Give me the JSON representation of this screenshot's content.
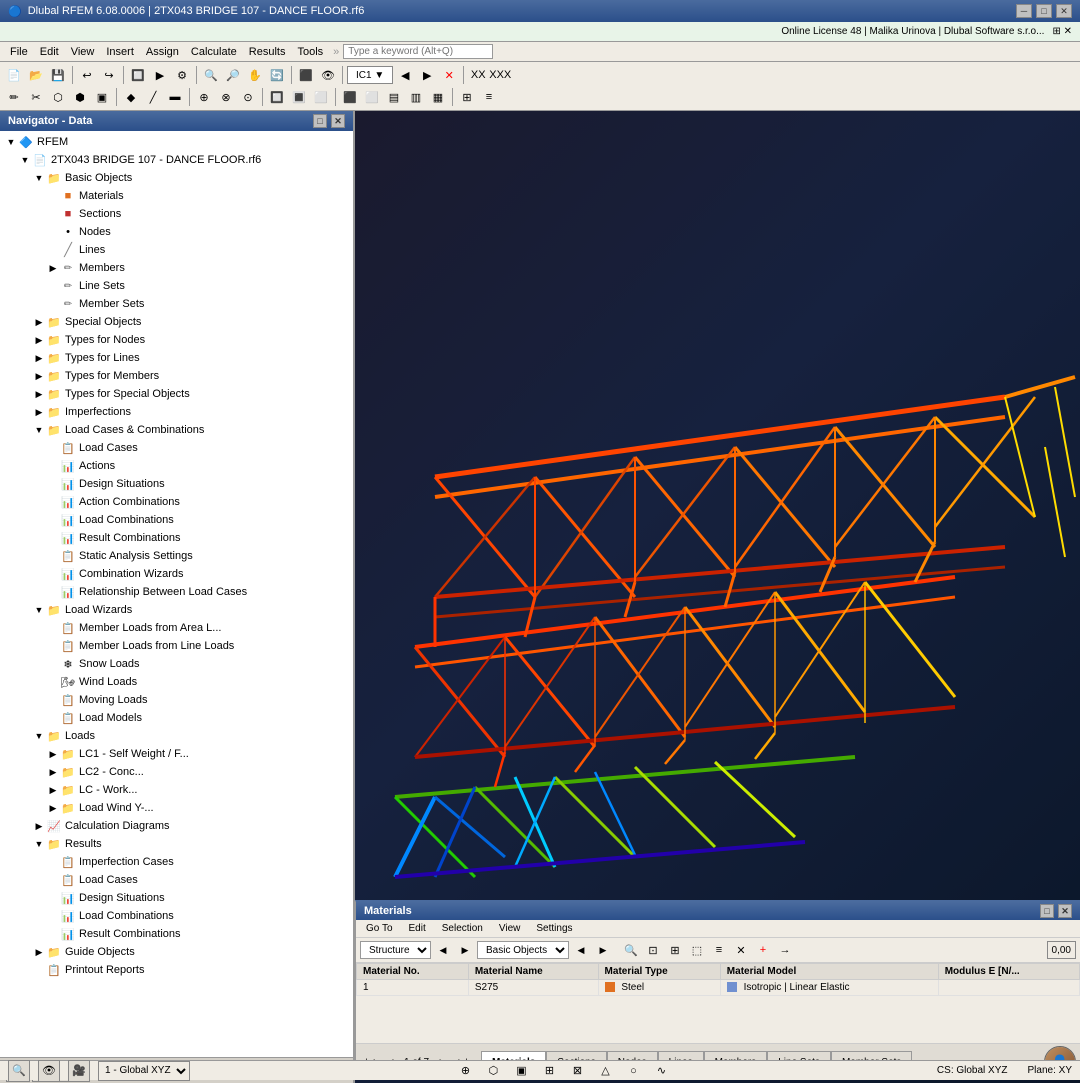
{
  "titlebar": {
    "icon": "🔵",
    "title": "Dlubal RFEM 6.08.0006 | 2TX043 BRIDGE 107 - DANCE FLOOR.rf6",
    "minimize": "─",
    "maximize": "□",
    "close": "✕"
  },
  "menubar": {
    "items": [
      "File",
      "Edit",
      "View",
      "Insert",
      "Assign",
      "Calculate",
      "Results",
      "Tools"
    ],
    "search_placeholder": "Type a keyword (Alt+Q)",
    "online_label": "Online License 48 | Malika Urinova | Dlubal Software s.r.o..."
  },
  "navigator": {
    "title": "Navigator - Data",
    "rfem_label": "RFEM",
    "project_label": "2TX043 BRIDGE 107 - DANCE FLOOR.rf6",
    "tree": [
      {
        "id": "basic-objects",
        "level": 1,
        "label": "Basic Objects",
        "icon": "📁",
        "expanded": true
      },
      {
        "id": "materials",
        "level": 2,
        "label": "Materials",
        "icon": "🟧"
      },
      {
        "id": "sections",
        "level": 2,
        "label": "Sections",
        "icon": "🟥"
      },
      {
        "id": "nodes",
        "level": 2,
        "label": "Nodes",
        "icon": "•"
      },
      {
        "id": "lines",
        "level": 2,
        "label": "Lines",
        "icon": "/"
      },
      {
        "id": "members",
        "level": 2,
        "label": "Members",
        "icon": "✏"
      },
      {
        "id": "line-sets",
        "level": 2,
        "label": "Line Sets",
        "icon": "✏"
      },
      {
        "id": "member-sets",
        "level": 2,
        "label": "Member Sets",
        "icon": "✏"
      },
      {
        "id": "special-objects",
        "level": 1,
        "label": "Special Objects",
        "icon": "📁",
        "expanded": false
      },
      {
        "id": "types-nodes",
        "level": 1,
        "label": "Types for Nodes",
        "icon": "📁",
        "expanded": false
      },
      {
        "id": "types-lines",
        "level": 1,
        "label": "Types for Lines",
        "icon": "📁",
        "expanded": false
      },
      {
        "id": "types-members",
        "level": 1,
        "label": "Types for Members",
        "icon": "📁",
        "expanded": false
      },
      {
        "id": "types-special",
        "level": 1,
        "label": "Types for Special Objects",
        "icon": "📁",
        "expanded": false
      },
      {
        "id": "imperfections",
        "level": 1,
        "label": "Imperfections",
        "icon": "📁",
        "expanded": false
      },
      {
        "id": "load-cases-combinations",
        "level": 1,
        "label": "Load Cases & Combinations",
        "icon": "📁",
        "expanded": true
      },
      {
        "id": "load-cases",
        "level": 2,
        "label": "Load Cases",
        "icon": "📋"
      },
      {
        "id": "actions",
        "level": 2,
        "label": "Actions",
        "icon": "📊"
      },
      {
        "id": "design-situations",
        "level": 2,
        "label": "Design Situations",
        "icon": "📊"
      },
      {
        "id": "action-combinations",
        "level": 2,
        "label": "Action Combinations",
        "icon": "📊"
      },
      {
        "id": "load-combinations",
        "level": 2,
        "label": "Load Combinations",
        "icon": "📊"
      },
      {
        "id": "result-combinations",
        "level": 2,
        "label": "Result Combinations",
        "icon": "📊"
      },
      {
        "id": "static-analysis-settings",
        "level": 2,
        "label": "Static Analysis Settings",
        "icon": "📋"
      },
      {
        "id": "combination-wizards",
        "level": 2,
        "label": "Combination Wizards",
        "icon": "📊"
      },
      {
        "id": "relationship-load-cases",
        "level": 2,
        "label": "Relationship Between Load Cases",
        "icon": "📊"
      },
      {
        "id": "load-wizards",
        "level": 1,
        "label": "Load Wizards",
        "icon": "📁",
        "expanded": true
      },
      {
        "id": "member-loads-area",
        "level": 2,
        "label": "Member Loads from Area Loads",
        "icon": "📋"
      },
      {
        "id": "member-loads-line",
        "level": 2,
        "label": "Member Loads from Line Loads",
        "icon": "📋"
      },
      {
        "id": "snow-loads",
        "level": 2,
        "label": "Snow Loads",
        "icon": "❄"
      },
      {
        "id": "wind-loads",
        "level": 2,
        "label": "Wind Loads",
        "icon": "🌬"
      },
      {
        "id": "moving-loads",
        "level": 2,
        "label": "Moving Loads",
        "icon": "📋"
      },
      {
        "id": "load-models",
        "level": 2,
        "label": "Load Models",
        "icon": "📋"
      },
      {
        "id": "loads",
        "level": 1,
        "label": "Loads",
        "icon": "📁",
        "expanded": true
      },
      {
        "id": "lc1",
        "level": 2,
        "label": "LC1 - Self Weight / F...",
        "icon": "📁"
      },
      {
        "id": "lc2",
        "level": 2,
        "label": "LC2 - Conc...",
        "icon": "📁"
      },
      {
        "id": "lc3",
        "level": 2,
        "label": "LC - Work...",
        "icon": "📁"
      },
      {
        "id": "lc4",
        "level": 2,
        "label": "Load Wind Y-...",
        "icon": "📁"
      },
      {
        "id": "calc-diagrams",
        "level": 1,
        "label": "Calculation Diagrams",
        "icon": "📈"
      },
      {
        "id": "results",
        "level": 1,
        "label": "Results",
        "icon": "📁",
        "expanded": true
      },
      {
        "id": "imperfection-cases",
        "level": 2,
        "label": "Imperfection Cases",
        "icon": "📋"
      },
      {
        "id": "res-load-cases",
        "level": 2,
        "label": "Load Cases",
        "icon": "📋"
      },
      {
        "id": "res-design-situations",
        "level": 2,
        "label": "Design Situations",
        "icon": "📊"
      },
      {
        "id": "res-load-combinations",
        "level": 2,
        "label": "Load Combinations",
        "icon": "📊"
      },
      {
        "id": "res-result-combinations",
        "level": 2,
        "label": "Result Combinations",
        "icon": "📊"
      },
      {
        "id": "guide-objects",
        "level": 1,
        "label": "Guide Objects",
        "icon": "📁",
        "expanded": false
      },
      {
        "id": "printout-reports",
        "level": 1,
        "label": "Printout Reports",
        "icon": "📋"
      }
    ]
  },
  "materials_panel": {
    "title": "Materials",
    "menu_items": [
      "Go To",
      "Edit",
      "Selection",
      "View",
      "Settings"
    ],
    "toolbar": {
      "dropdown1": "Structure",
      "dropdown2": "Basic Objects"
    },
    "table": {
      "columns": [
        "Material No.",
        "Material Name",
        "Material Type",
        "Material Model",
        "Modulus E [N/..."
      ],
      "rows": [
        {
          "no": "1",
          "name": "S275",
          "type": "Steel",
          "model": "Isotropic | Linear Elastic",
          "modulus": ""
        }
      ]
    },
    "bottom_info": "1 of 7",
    "tabs": [
      "Materials",
      "Sections",
      "Nodes",
      "Lines",
      "Members",
      "Line Sets",
      "Member Sets"
    ]
  },
  "statusbar": {
    "cs_label": "CS: Global XYZ",
    "plane_label": "Plane: XY"
  },
  "bottom_nav": {
    "coord_label": "1 - Global XYZ"
  }
}
